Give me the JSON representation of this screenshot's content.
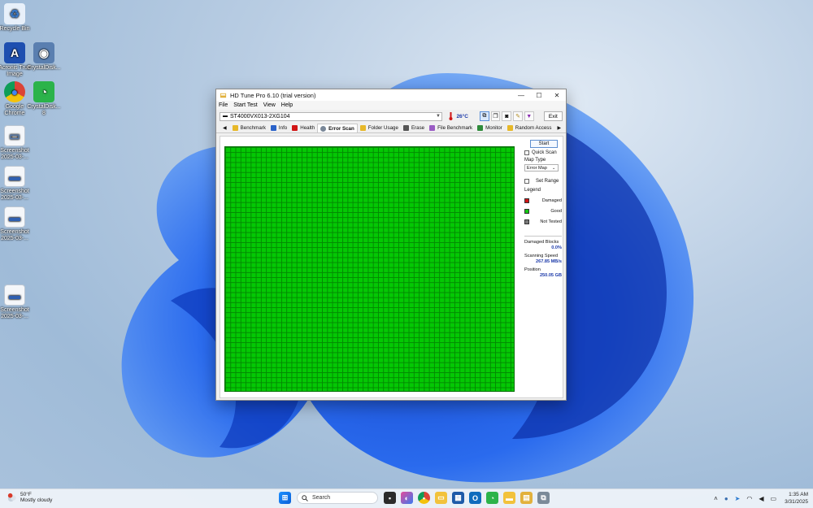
{
  "desktop": {
    "icons": [
      {
        "label": "Recycle Bin"
      },
      {
        "label": "Acronis True Image"
      },
      {
        "label": "CrystalDisk..."
      },
      {
        "label": "Google Chrome"
      },
      {
        "label": "CrystalDisk... 8"
      },
      {
        "label": "Screenshot 2025-03-..."
      },
      {
        "label": "Screenshot 2025-03-..."
      },
      {
        "label": "Screenshot 2025-03-..."
      },
      {
        "label": "Screenshot 2025-03-..."
      }
    ]
  },
  "window": {
    "title": "HD Tune Pro 6.10 (trial version)",
    "minimize": "—",
    "maximize": "☐",
    "close": "✕",
    "menu": [
      "File",
      "Start Test",
      "View",
      "Help"
    ],
    "drive": "ST4000VX013-2XG104",
    "temperature": "26°C",
    "exit_label": "Exit",
    "tabs": [
      "Benchmark",
      "Info",
      "Health",
      "Error Scan",
      "Folder Usage",
      "Erase",
      "File Benchmark",
      "Monitor",
      "Random Access"
    ],
    "active_tab": "Error Scan",
    "tab_prev": "◀",
    "tab_next": "▶"
  },
  "side_panel": {
    "start_label": "Start",
    "quick_scan_label": "Quick Scan",
    "quick_scan_checked": false,
    "map_type_label": "Map Type",
    "map_type_value": "Error Map",
    "set_range_label": "Set Range",
    "set_range_checked": false,
    "legend_label": "Legend",
    "legend": [
      {
        "label": "Damaged",
        "color": "#d11414"
      },
      {
        "label": "Good",
        "color": "#12c812"
      },
      {
        "label": "Not Tested",
        "color": "#7a7a7a"
      }
    ],
    "damaged_blocks_label": "Damaged Blocks",
    "damaged_blocks_value": "0.0%",
    "scanning_speed_label": "Scanning Speed",
    "scanning_speed_value": "267.85 MB/s",
    "position_label": "Position",
    "position_value": "250.05 GB"
  },
  "error_map": {
    "status": "good",
    "color": "#04c804"
  },
  "taskbar": {
    "weather_temp": "50°F",
    "weather_desc": "Mostly cloudy",
    "search_placeholder": "Search",
    "time": "1:35 AM",
    "date": "3/31/2025"
  }
}
